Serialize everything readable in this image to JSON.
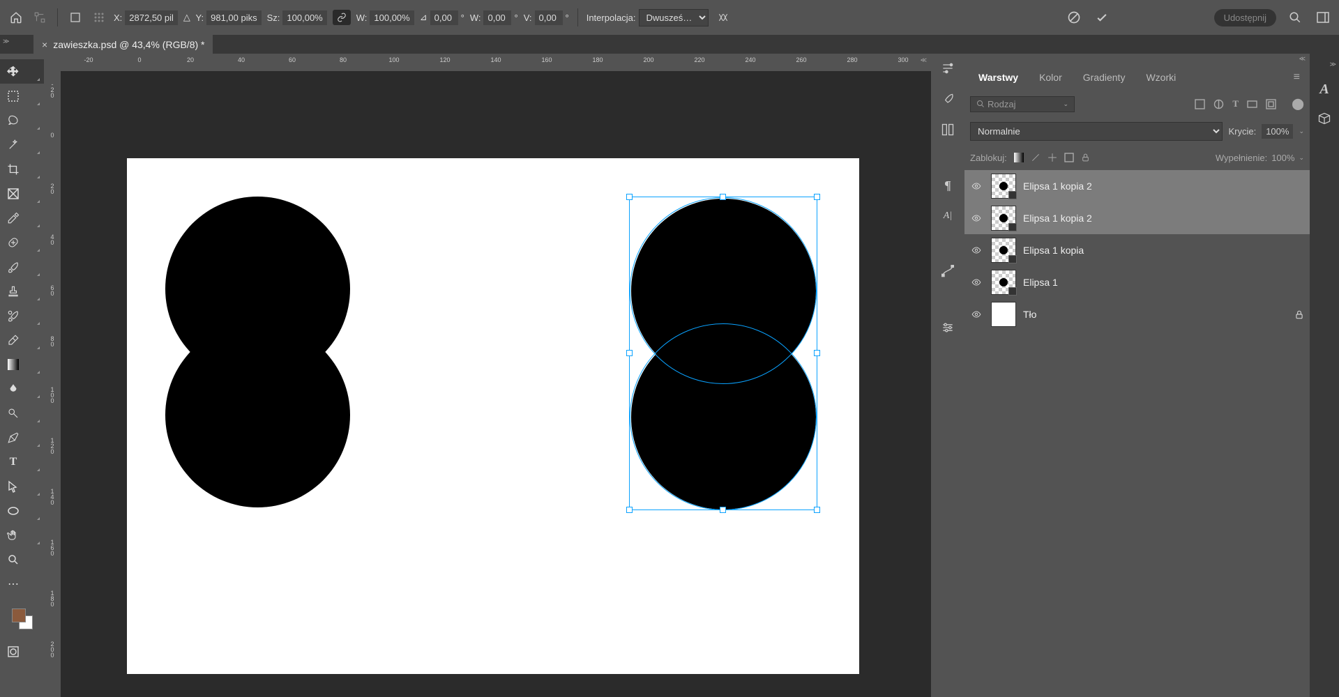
{
  "options": {
    "x_label": "X:",
    "x_val": "2872,50 pil",
    "y_label": "Y:",
    "y_val": "981,00 piks",
    "sz_label": "Sz:",
    "sz_val": "100,00%",
    "w_label": "W:",
    "w_val": "100,00%",
    "angle_label": "∠",
    "angle_val": "0,00",
    "angle_unit": "°",
    "hw_label": "W:",
    "hw_val": "0,00",
    "hw_unit": "°",
    "v_label": "V:",
    "v_val": "0,00",
    "v_unit": "°",
    "interp_label": "Interpolacja:",
    "interp_val": "Dwusześ…",
    "share": "Udostępnij"
  },
  "tab": {
    "title": "zawieszka.psd @ 43,4% (RGB/8) *"
  },
  "ruler_h": [
    "-20",
    "0",
    "20",
    "40",
    "60",
    "80",
    "100",
    "120",
    "140",
    "160",
    "180",
    "200",
    "220",
    "240",
    "260",
    "280",
    "300"
  ],
  "ruler_v": [
    "-20",
    "0",
    "20",
    "40",
    "60",
    "80",
    "100",
    "120",
    "140",
    "160",
    "180",
    "200"
  ],
  "tools": [
    "move",
    "marquee",
    "lasso",
    "wand",
    "crop",
    "frame",
    "eyedropper",
    "healing",
    "brush",
    "stamp",
    "history",
    "eraser",
    "gradient",
    "blur",
    "dodge",
    "pen",
    "type",
    "path",
    "ellipse",
    "hand",
    "zoom",
    "more"
  ],
  "panels": {
    "tabs": [
      "Warstwy",
      "Kolor",
      "Gradienty",
      "Wzorki"
    ],
    "search_placeholder": "Rodzaj",
    "blend_mode": "Normalnie",
    "opacity_label": "Krycie:",
    "opacity_val": "100%",
    "lock_label": "Zablokuj:",
    "fill_label": "Wypełnienie:",
    "fill_val": "100%",
    "layers": [
      {
        "name": "Elipsa 1 kopia 2",
        "selected": true,
        "thumb": "shape"
      },
      {
        "name": "Elipsa 1 kopia 2",
        "selected": true,
        "thumb": "shape"
      },
      {
        "name": "Elipsa 1 kopia",
        "selected": false,
        "thumb": "shape"
      },
      {
        "name": "Elipsa 1",
        "selected": false,
        "thumb": "shape"
      },
      {
        "name": "Tło",
        "selected": false,
        "thumb": "white",
        "locked": true
      }
    ]
  }
}
